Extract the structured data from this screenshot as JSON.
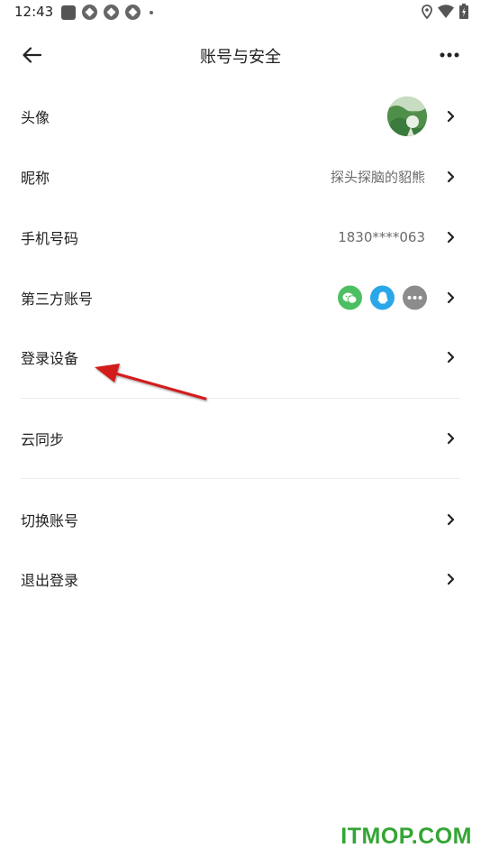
{
  "status_bar": {
    "time": "12:43"
  },
  "header": {
    "title": "账号与安全"
  },
  "rows": {
    "avatar": {
      "label": "头像"
    },
    "nickname": {
      "label": "昵称",
      "value": "探头探脑的貂熊"
    },
    "phone": {
      "label": "手机号码",
      "value": "1830****063"
    },
    "third_party": {
      "label": "第三方账号",
      "icons": [
        "wechat-icon",
        "qq-icon",
        "more-icon"
      ]
    },
    "devices": {
      "label": "登录设备"
    },
    "cloud_sync": {
      "label": "云同步"
    },
    "switch_account": {
      "label": "切换账号"
    },
    "logout": {
      "label": "退出登录"
    }
  },
  "colors": {
    "wechat": "#4cbf62",
    "qq": "#2aa7e9",
    "more": "#8c8c8c",
    "arrow": "#d21f1f",
    "watermark": "#35a535"
  },
  "watermark": "ITMOP.COM"
}
